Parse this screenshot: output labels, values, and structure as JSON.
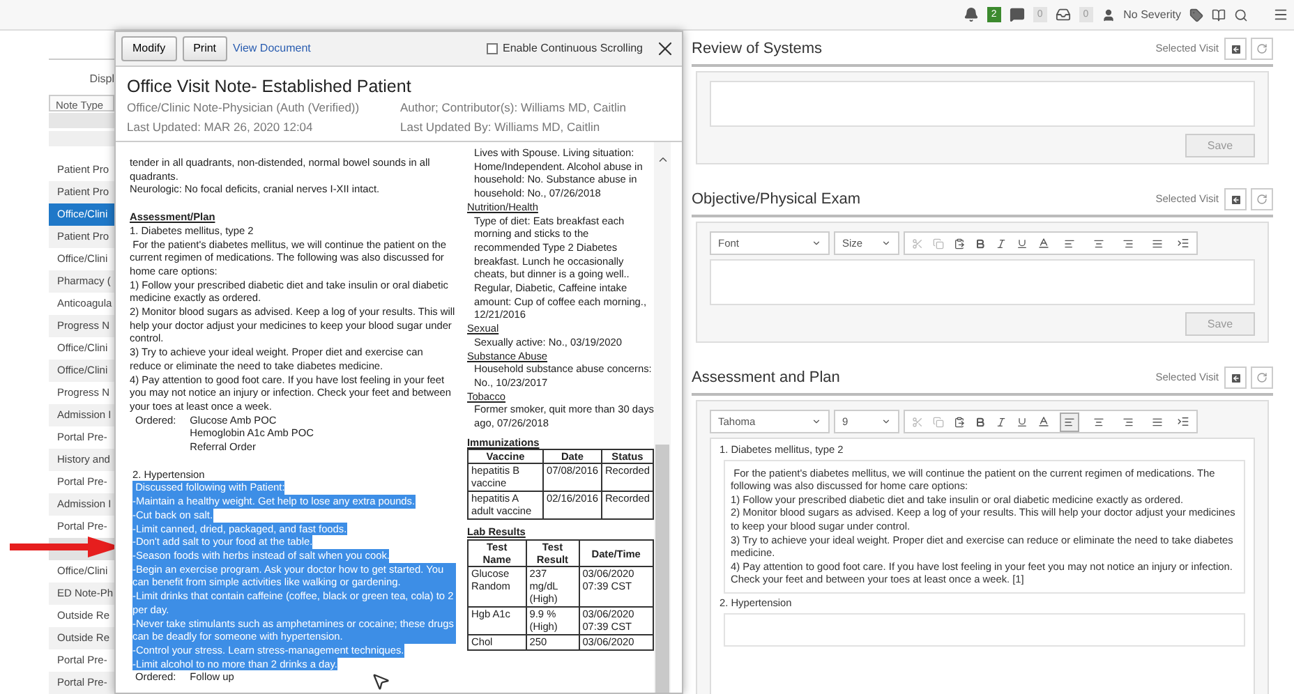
{
  "top_bar": {
    "alerts_count": "2",
    "messages_count": "0",
    "inbox_count": "0",
    "severity": "No Severity"
  },
  "note_list": {
    "display_label": "Displ",
    "column_header": "Note Type",
    "items": [
      {
        "label": "Patient Pro",
        "selected": false,
        "obscured": false
      },
      {
        "label": "Patient Pro",
        "selected": false,
        "obscured": false
      },
      {
        "label": "Office/Clini",
        "selected": true,
        "obscured": false
      },
      {
        "label": "Patient Pro",
        "selected": false,
        "obscured": false
      },
      {
        "label": "Office/Clini",
        "selected": false,
        "obscured": false
      },
      {
        "label": "Pharmacy (",
        "selected": false,
        "obscured": false
      },
      {
        "label": "Anticoagula",
        "selected": false,
        "obscured": false
      },
      {
        "label": "Progress N",
        "selected": false,
        "obscured": false
      },
      {
        "label": "Office/Clini",
        "selected": false,
        "obscured": false
      },
      {
        "label": "Office/Clini",
        "selected": false,
        "obscured": false
      },
      {
        "label": "Progress N",
        "selected": false,
        "obscured": false
      },
      {
        "label": "Admission I",
        "selected": false,
        "obscured": false
      },
      {
        "label": "Portal Pre-",
        "selected": false,
        "obscured": false
      },
      {
        "label": "History and",
        "selected": false,
        "obscured": false
      },
      {
        "label": "Portal Pre-",
        "selected": false,
        "obscured": false
      },
      {
        "label": "Admission I",
        "selected": false,
        "obscured": false
      },
      {
        "label": "Portal Pre-",
        "selected": false,
        "obscured": false
      },
      {
        "selected": false,
        "obscured": true
      },
      {
        "label": "Office/Clini",
        "selected": false,
        "obscured": false
      },
      {
        "label": "ED Note-Ph",
        "selected": false,
        "obscured": false
      },
      {
        "label": "Outside Re",
        "selected": false,
        "obscured": false
      },
      {
        "label": "Outside Re",
        "selected": false,
        "obscured": false
      },
      {
        "label": "Portal Pre-",
        "selected": false,
        "obscured": false
      },
      {
        "label": "Portal Pre-",
        "selected": false,
        "obscured": false
      }
    ]
  },
  "document": {
    "buttons": [
      "Modify",
      "Print"
    ],
    "link": "View Document",
    "continuous_scrolling": {
      "label": "Enable Continuous Scrolling",
      "checked": false
    },
    "title": "Office Visit Note- Established Patient",
    "note_type": "Office/Clinic Note-Physician (Auth (Verified))",
    "author": "Author; Contributor(s): Williams MD, Caitlin",
    "last_updated": "Last Updated: MAR 26, 2020 12:04",
    "last_updated_by": "Last Updated By: Williams MD, Caitlin",
    "left_column": [
      {
        "kind": "text",
        "text": "tender in all quadrants, non-distended, normal bowel sounds in all quadrants."
      },
      {
        "kind": "text",
        "text": "Neurologic: No focal deficits, cranial nerves I-XII intact."
      },
      {
        "kind": "heading",
        "text": "Assessment/Plan"
      },
      {
        "kind": "text",
        "text": "1. Diabetes mellitus, type 2"
      },
      {
        "kind": "text",
        "text": " For the patient's diabetes mellitus, we will continue the patient on the current regimen of medications. The following was also discussed for home care options:"
      },
      {
        "kind": "text",
        "text": "1) Follow your prescribed diabetic diet and take insulin or oral diabetic medicine exactly as ordered."
      },
      {
        "kind": "text",
        "text": "2) Monitor blood sugars as advised. Keep a log of your results. This will help your doctor adjust your medicines to keep your blood sugar under control."
      },
      {
        "kind": "text",
        "text": "3) Try to achieve your ideal weight. Proper diet and exercise can reduce or eliminate the need to take diabetes medicine."
      },
      {
        "kind": "text",
        "text": "4) Pay attention to good foot care. If you have lost feeling in your feet you may not notice an injury or infection. Check your feet and between your toes at least once a week."
      },
      {
        "kind": "order",
        "label": "Ordered:",
        "items": [
          "Glucose Amb POC",
          "Hemoglobin A1c Amb POC",
          "Referral Order"
        ]
      },
      {
        "kind": "problem",
        "text": "2. Hypertension"
      },
      {
        "kind": "highlight",
        "text": " Discussed following with Patient:"
      },
      {
        "kind": "highlight",
        "text": "-Maintain a healthy weight. Get help to lose any extra pounds."
      },
      {
        "kind": "highlight",
        "text": "-Cut back on salt."
      },
      {
        "kind": "highlight",
        "text": "-Limit canned, dried, packaged, and fast foods."
      },
      {
        "kind": "highlight",
        "text": "-Don't add salt to your food at the table."
      },
      {
        "kind": "highlight",
        "text": "-Season foods with herbs instead of salt when you cook."
      },
      {
        "kind": "highlight",
        "text": "-Begin an exercise program. Ask your doctor how to get started. You can benefit from simple activities like walking or gardening."
      },
      {
        "kind": "highlight",
        "text": "-Limit drinks that contain caffeine (coffee, black or green tea, cola) to 2 per day."
      },
      {
        "kind": "highlight",
        "text": "-Never take stimulants such as amphetamines or cocaine; these drugs can be deadly for someone with hypertension."
      },
      {
        "kind": "highlight",
        "text": "-Control your stress. Learn stress-management techniques."
      },
      {
        "kind": "highlight",
        "text": "-Limit alcohol to no more than 2 drinks a day."
      },
      {
        "kind": "order",
        "label": "Ordered:",
        "items": [
          "Follow up"
        ]
      }
    ],
    "right_column": [
      {
        "kind": "text",
        "text": "Lives with Spouse. Living situation: Home/Independent. Alcohol abuse in household: No. Substance abuse in household: No., 07/26/2018"
      },
      {
        "kind": "section",
        "text": "Nutrition/Health"
      },
      {
        "kind": "text",
        "text": "Type of diet: Eats breakfast each morning and sticks to the recommended Type 2 Diabetes breakfast. Lunch he occasionally cheats, but dinner is a going well.. Regular, Diabetic, Caffeine intake amount: Cup of coffee each morning., 12/21/2016"
      },
      {
        "kind": "section",
        "text": "Sexual"
      },
      {
        "kind": "text",
        "text": "Sexually active: No., 03/19/2020"
      },
      {
        "kind": "section",
        "text": "Substance Abuse"
      },
      {
        "kind": "text",
        "text": "Household substance abuse concerns: No., 10/23/2017"
      },
      {
        "kind": "section",
        "text": "Tobacco"
      },
      {
        "kind": "text",
        "text": "Former smoker, quit more than 30 days ago, 07/26/2018"
      },
      {
        "kind": "table",
        "title": "Immunizations",
        "columns": [
          "Vaccine",
          "Date",
          "Status"
        ],
        "rows": [
          [
            "hepatitis B vaccine",
            "07/08/2016",
            "Recorded"
          ],
          [
            "hepatitis A adult vaccine",
            "02/16/2016",
            "Recorded"
          ]
        ]
      },
      {
        "kind": "table",
        "title": "Lab Results",
        "columns": [
          "Test Name",
          "Test Result",
          "Date/Time"
        ],
        "rows": [
          [
            "Glucose Random",
            "237 mg/dL (High)",
            "03/06/2020 07:39 CST"
          ],
          [
            "Hgb A1c",
            "9.9 % (High)",
            "03/06/2020 07:39 CST"
          ],
          [
            "Chol",
            "250",
            "03/06/2020"
          ]
        ]
      }
    ]
  },
  "sections": [
    {
      "title": "Review of Systems",
      "visit_label": "Selected Visit",
      "save": "Save",
      "editor": {
        "kind": "empty"
      }
    },
    {
      "title": "Objective/Physical Exam",
      "visit_label": "Selected Visit",
      "save": "Save",
      "editor": {
        "kind": "empty",
        "font": "Font",
        "size": "Size",
        "align_left_active": false
      }
    },
    {
      "title": "Assessment and Plan",
      "visit_label": "Selected Visit",
      "editor": {
        "kind": "problems",
        "font": "Tahoma",
        "size": "9",
        "align_left_active": true,
        "problems": [
          {
            "title": "1. Diabetes mellitus, type 2",
            "paragraphs": [
              " For the patient's diabetes mellitus, we will continue the patient on the current regimen of medications. The following was also discussed for home care options:",
              "1) Follow your prescribed diabetic diet and take insulin or oral diabetic medicine exactly as ordered.",
              "2) Monitor blood sugars as advised. Keep a log of your results. This will help your doctor adjust your medicines to keep your blood sugar under control.",
              "3) Try to achieve your ideal weight. Proper diet and exercise can reduce or eliminate the need to take diabetes medicine.",
              "4) Pay attention to good foot care. If you have lost feeling in your feet you may not notice an injury or infection. Check your feet and between your toes at least once a week. [1]"
            ]
          },
          {
            "title": "2. Hypertension"
          }
        ]
      }
    }
  ]
}
